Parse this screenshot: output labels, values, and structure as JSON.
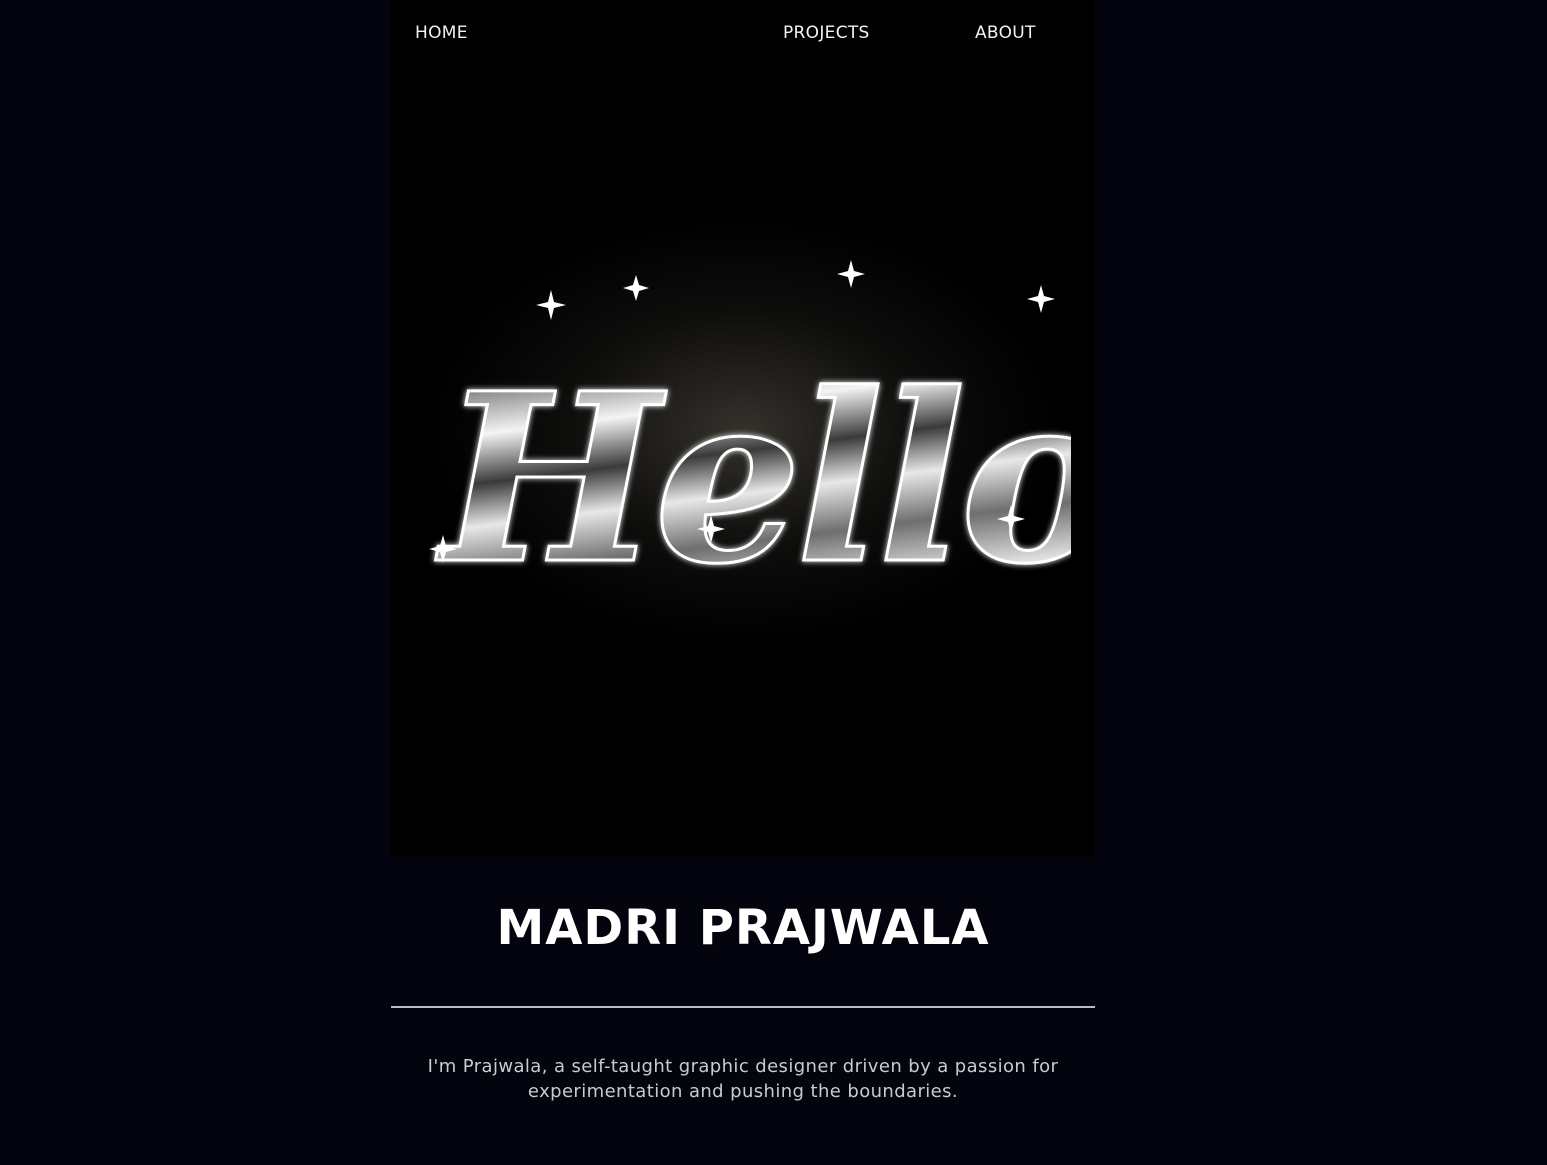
{
  "nav": {
    "home": "HOME",
    "projects": "PROJECTS",
    "about": "ABOUT"
  },
  "hero": {
    "greeting": "Hello!"
  },
  "profile": {
    "name": "MADRI PRAJWALA",
    "bio": "I'm Prajwala, a self-taught graphic designer driven by a passion for experimentation and pushing the boundaries."
  },
  "colors": {
    "background": "#03040d",
    "hero_background": "#000000",
    "text": "#ffffff",
    "divider": "#b9bcc4"
  }
}
